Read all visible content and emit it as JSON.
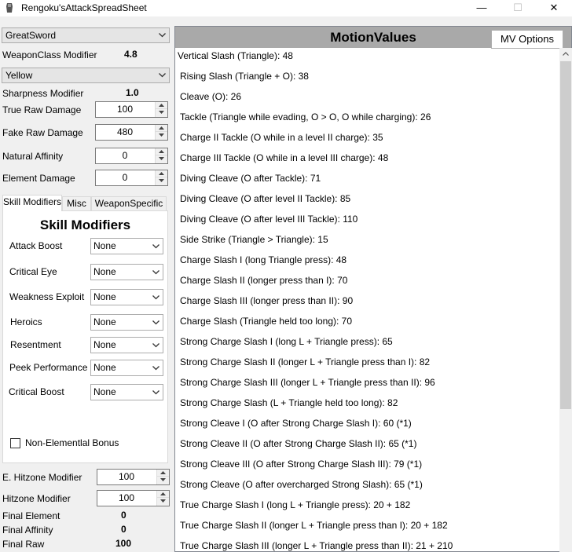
{
  "window": {
    "title": "Rengoku'sAttackSpreadSheet",
    "minimize_glyph": "—",
    "maximize_glyph": "☐",
    "close_glyph": "✕"
  },
  "weapon": {
    "selected": "GreatSword"
  },
  "weapon_class_modifier": {
    "label": "WeaponClass Modifier",
    "value": "4.8"
  },
  "sharpness": {
    "selected": "Yellow"
  },
  "sharpness_modifier": {
    "label": "Sharpness Modifier",
    "value": "1.0"
  },
  "fields": [
    {
      "label": "True Raw Damage",
      "value": "100"
    },
    {
      "label": "Fake Raw Damage",
      "value": "480"
    },
    {
      "label": "Natural Affinity",
      "value": "0"
    },
    {
      "label": "Element Damage",
      "value": "0"
    }
  ],
  "tabs": [
    "Skill Modifiers",
    "Misc",
    "WeaponSpecific"
  ],
  "skill_modifiers": {
    "title": "Skill Modifiers",
    "items": [
      {
        "label": "Attack Boost",
        "value": "None"
      },
      {
        "label": "Critical Eye",
        "value": "None"
      },
      {
        "label": "Weakness Exploit",
        "value": "None"
      },
      {
        "label": "Heroics",
        "value": "None"
      },
      {
        "label": "Resentment",
        "value": "None"
      },
      {
        "label": "Peek Performance",
        "value": "None"
      },
      {
        "label": "Critical Boost",
        "value": "None"
      }
    ],
    "checkbox_label": "Non-Elementlal Bonus",
    "checkbox_checked": false
  },
  "hitzones": [
    {
      "label": "E. Hitzone Modifier",
      "value": "100"
    },
    {
      "label": "Hitzone Modifier",
      "value": "100"
    }
  ],
  "results": [
    {
      "label": "Final Element",
      "value": "0"
    },
    {
      "label": "Final Affinity",
      "value": "0"
    },
    {
      "label": "Final Raw",
      "value": "100"
    }
  ],
  "motion_values": {
    "title": "MotionValues",
    "options_button": "MV Options",
    "rows": [
      "Vertical Slash (Triangle): 48",
      "Rising Slash (Triangle + O): 38",
      "Cleave (O): 26",
      "Tackle (Triangle while evading, O > O, O while charging): 26",
      "Charge II Tackle (O while in a level II charge): 35",
      "Charge III Tackle (O while in a level III charge): 48",
      "Diving Cleave (O after Tackle): 71",
      "Diving Cleave (O after level II Tackle): 85",
      "Diving Cleave (O after level III Tackle): 110",
      "Side Strike (Triangle > Triangle): 15",
      "Charge Slash I (long Triangle press): 48",
      "Charge Slash II (longer press than I): 70",
      "Charge Slash III (longer press than II): 90",
      "Charge Slash (Triangle held too long): 70",
      "Strong Charge Slash I (long L + Triangle press): 65",
      "Strong Charge Slash II (longer L + Triangle press than I): 82",
      "Strong Charge Slash III (longer L + Triangle press than II): 96",
      "Strong Charge Slash (L + Triangle held too long): 82",
      "Strong Cleave I (O after Strong Charge Slash I): 60  (*1)",
      "Strong Cleave II (O after Strong Charge Slash II): 65  (*1)",
      "Strong Cleave III (O after Strong Charge Slash III): 79  (*1)",
      "Strong Cleave (O after overcharged Strong Slash): 65  (*1)",
      "True Charge Slash I (long L + Triangle press): 20  + 182",
      "True Charge Slash II (longer L + Triangle press than I): 20  + 182",
      "True Charge Slash III (longer L + Triangle press than II): 21  + 210"
    ]
  }
}
